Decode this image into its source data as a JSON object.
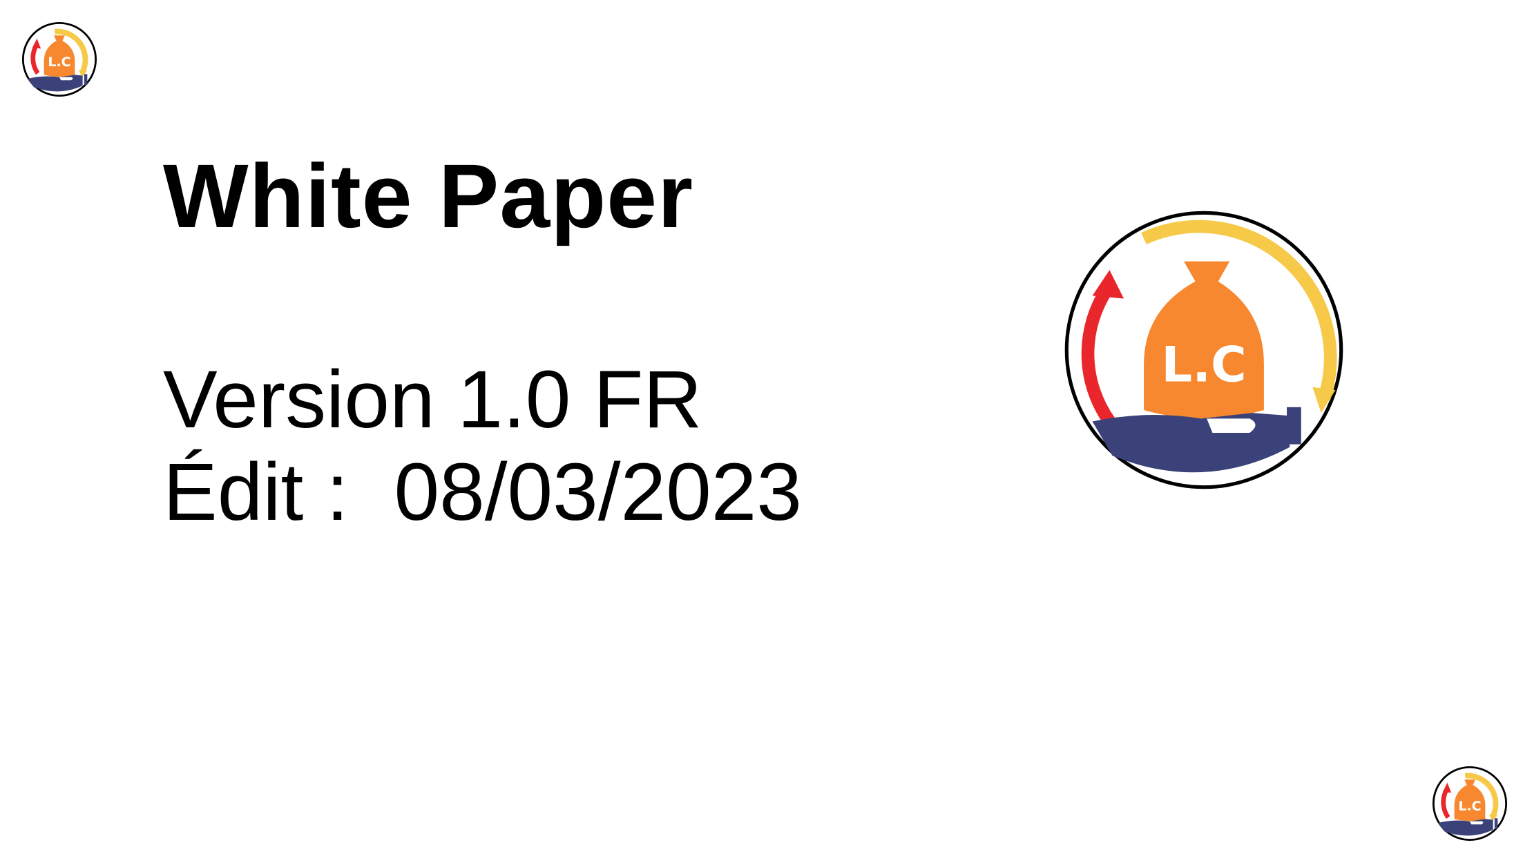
{
  "document": {
    "title": "White Paper",
    "version": "Version 1.0 FR",
    "edit_date": "Édit :  08/03/2023"
  },
  "logo": {
    "text": "L.C",
    "icon": "lc-logo-icon",
    "colors": {
      "ring": "#000000",
      "arc_yellow": "#F7C948",
      "arrow_red": "#E8262B",
      "bag_orange": "#F7882F",
      "hand_navy": "#3B4279",
      "text_white": "#FFFFFF"
    }
  }
}
